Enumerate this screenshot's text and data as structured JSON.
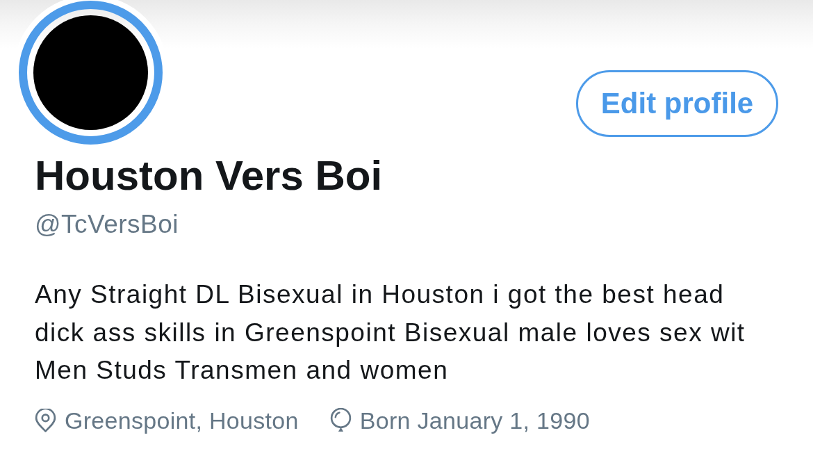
{
  "profile": {
    "edit_button": "Edit profile",
    "name": "Houston Vers Boi",
    "handle": "@TcVersBoi",
    "bio": "Any Straight DL Bisexual in Houston i got the best head dick ass skills in Greenspoint Bisexual male loves sex wit Men Studs Transmen and women",
    "meta": [
      {
        "kind": "location",
        "text": "Greenspoint, Houston"
      },
      {
        "kind": "birthday",
        "text": "Born January 1, 1990"
      }
    ]
  }
}
